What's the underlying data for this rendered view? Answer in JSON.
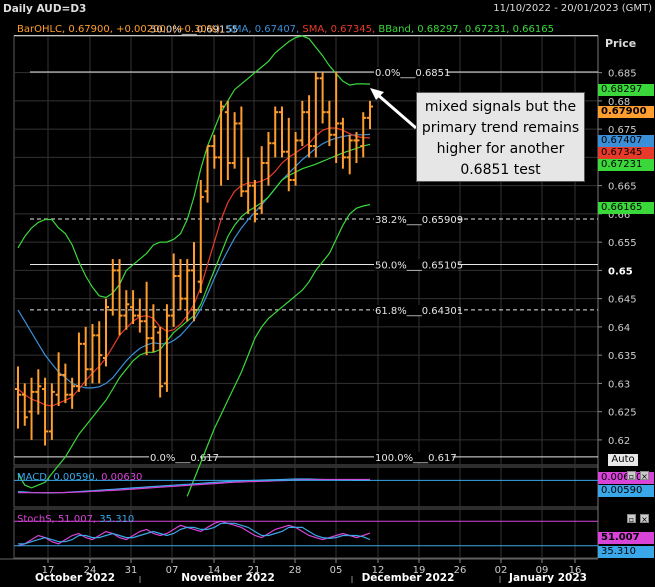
{
  "header": {
    "title": "Daily AUD=D3",
    "date_range": "11/10/2022 - 20/01/2023 (GMT)"
  },
  "legend": {
    "barohlc": "BarOHLC, 0.67900, +0.00200, (+0.30%),",
    "sma1": "SMA, 0.67407,",
    "sma2": "SMA, 0.67345,",
    "bband": "BBand, 0.68297, 0.67231, 0.66165",
    "colors": {
      "barohlc": "#ff9d2e",
      "sma1": "#3a8fd8",
      "sma2": "#e83a2a",
      "bband": "#3bd83b"
    }
  },
  "price_axis_title": "Price",
  "auto_button": "Auto",
  "callout": {
    "line1": "mixed signals but the",
    "line2": "primary trend remains",
    "line3": "higher for another",
    "line4": "0.6851 test"
  },
  "price_boxes": {
    "bb_upper": "0.68297",
    "close": "0.67900",
    "sma1": "0.67407",
    "sma2": "0.67345",
    "bb_mid": "0.67231",
    "bb_lower": "0.66165"
  },
  "macd": {
    "legend_label": "MACD,",
    "value1": "0.00590,",
    "value2": "0.00630",
    "box1": "0.00630",
    "box2": "0.00590"
  },
  "stochs": {
    "legend_label": "StochS,",
    "value1": "51.007,",
    "value2": "35.310",
    "box1": "51.007",
    "box2": "35.310"
  },
  "chart_data": {
    "type": "bar",
    "subtype": "ohlc",
    "title": "Daily AUD=D3",
    "ylim": [
      0.615,
      0.6915
    ],
    "y_ticks": [
      "0.685",
      "0.68",
      "0.675",
      "0.67",
      "0.665",
      "0.66",
      "0.655",
      "0.65",
      "0.645",
      "0.64",
      "0.635",
      "0.63",
      "0.625",
      "0.62"
    ],
    "y_ticks_bold": [
      "0.65"
    ],
    "x_day_labels": [
      "17",
      "24",
      "31",
      "07",
      "14",
      "21",
      "28",
      "05",
      "12",
      "19",
      "26",
      "02",
      "09",
      "16"
    ],
    "x_month_labels": [
      "October 2022",
      "November 2022",
      "December 2022",
      "January 2023"
    ],
    "fib_levels": [
      {
        "label": "50.0%",
        "value": 0.69155,
        "text": "0.69155"
      },
      {
        "label": "0.0%",
        "value": 0.6851,
        "text": "0.6851"
      },
      {
        "label": "38.2%",
        "value": 0.65909,
        "text": "0.65909"
      },
      {
        "label": "50.0%",
        "value": 0.65105,
        "text": "0.65105"
      },
      {
        "label": "61.8%",
        "value": 0.64301,
        "text": "0.64301"
      },
      {
        "label": "0.0%",
        "value": 0.617,
        "text": "0.617"
      },
      {
        "label": "100.0%",
        "value": 0.617,
        "text": "0.617"
      }
    ],
    "ohlc": [
      [
        0.629,
        0.633,
        0.622,
        0.628
      ],
      [
        0.628,
        0.63,
        0.6225,
        0.624
      ],
      [
        0.625,
        0.631,
        0.62,
        0.6285
      ],
      [
        0.6285,
        0.6325,
        0.6245,
        0.6295
      ],
      [
        0.629,
        0.631,
        0.619,
        0.6215
      ],
      [
        0.6215,
        0.63,
        0.62,
        0.6285
      ],
      [
        0.628,
        0.6355,
        0.626,
        0.6315
      ],
      [
        0.6315,
        0.6335,
        0.6265,
        0.628
      ],
      [
        0.628,
        0.631,
        0.6255,
        0.6295
      ],
      [
        0.6295,
        0.639,
        0.6285,
        0.637
      ],
      [
        0.637,
        0.64,
        0.6295,
        0.6325
      ],
      [
        0.6325,
        0.6405,
        0.63,
        0.6385
      ],
      [
        0.6385,
        0.641,
        0.63,
        0.635
      ],
      [
        0.6345,
        0.645,
        0.633,
        0.6435
      ],
      [
        0.643,
        0.652,
        0.642,
        0.65
      ],
      [
        0.65,
        0.652,
        0.6385,
        0.642
      ],
      [
        0.642,
        0.6465,
        0.6395,
        0.644
      ],
      [
        0.6435,
        0.6465,
        0.6405,
        0.642
      ],
      [
        0.642,
        0.645,
        0.639,
        0.641
      ],
      [
        0.641,
        0.648,
        0.635,
        0.638
      ],
      [
        0.638,
        0.644,
        0.6355,
        0.64
      ],
      [
        0.639,
        0.64,
        0.6275,
        0.6295
      ],
      [
        0.63,
        0.644,
        0.6285,
        0.642
      ],
      [
        0.642,
        0.653,
        0.64,
        0.649
      ],
      [
        0.649,
        0.652,
        0.643,
        0.645
      ],
      [
        0.645,
        0.652,
        0.641,
        0.65
      ],
      [
        0.65,
        0.655,
        0.641,
        0.643
      ],
      [
        0.648,
        0.666,
        0.646,
        0.663
      ],
      [
        0.664,
        0.672,
        0.662,
        0.672
      ],
      [
        0.672,
        0.674,
        0.668,
        0.67
      ],
      [
        0.67,
        0.68,
        0.665,
        0.679
      ],
      [
        0.678,
        0.68,
        0.666,
        0.669
      ],
      [
        0.669,
        0.678,
        0.668,
        0.676
      ],
      [
        0.676,
        0.679,
        0.663,
        0.664
      ],
      [
        0.664,
        0.67,
        0.66,
        0.665
      ],
      [
        0.665,
        0.666,
        0.6585,
        0.66
      ],
      [
        0.661,
        0.672,
        0.66,
        0.669
      ],
      [
        0.669,
        0.6745,
        0.665,
        0.6725
      ],
      [
        0.6725,
        0.679,
        0.67,
        0.678
      ],
      [
        0.678,
        0.679,
        0.67,
        0.671
      ],
      [
        0.671,
        0.677,
        0.664,
        0.666
      ],
      [
        0.666,
        0.6745,
        0.665,
        0.673
      ],
      [
        0.673,
        0.68,
        0.672,
        0.678
      ],
      [
        0.678,
        0.681,
        0.67,
        0.672
      ],
      [
        0.672,
        0.6851,
        0.67,
        0.684
      ],
      [
        0.684,
        0.6851,
        0.676,
        0.678
      ],
      [
        0.678,
        0.68,
        0.672,
        0.674
      ],
      [
        0.674,
        0.6851,
        0.669,
        0.676
      ],
      [
        0.676,
        0.677,
        0.668,
        0.67
      ],
      [
        0.67,
        0.674,
        0.667,
        0.673
      ],
      [
        0.673,
        0.6745,
        0.669,
        0.673
      ],
      [
        0.672,
        0.678,
        0.67,
        0.677
      ],
      [
        0.677,
        0.68,
        0.675,
        0.679
      ]
    ],
    "series": [
      {
        "name": "SMA",
        "color": "#3a8fd8",
        "values": [
          0.643,
          0.641,
          0.639,
          0.637,
          0.635,
          0.6335,
          0.632,
          0.631,
          0.63,
          0.6295,
          0.6292,
          0.6292,
          0.6294,
          0.63,
          0.631,
          0.6325,
          0.634,
          0.6352,
          0.6362,
          0.6368,
          0.6372,
          0.637,
          0.637,
          0.6376,
          0.6385,
          0.6398,
          0.6412,
          0.6432,
          0.6458,
          0.6486,
          0.6512,
          0.6535,
          0.6557,
          0.6575,
          0.659,
          0.6603,
          0.6616,
          0.663,
          0.6645,
          0.666,
          0.6672,
          0.6684,
          0.6696,
          0.6706,
          0.6716,
          0.6724,
          0.673,
          0.6734,
          0.6737,
          0.6739,
          0.674,
          0.674,
          0.67407
        ]
      },
      {
        "name": "SMA",
        "color": "#e83a2a",
        "values": [
          0.629,
          0.628,
          0.6272,
          0.6268,
          0.6262,
          0.626,
          0.6265,
          0.627,
          0.6276,
          0.629,
          0.6305,
          0.6318,
          0.633,
          0.6345,
          0.6365,
          0.6385,
          0.6398,
          0.641,
          0.6418,
          0.642,
          0.6415,
          0.64,
          0.6392,
          0.6395,
          0.6405,
          0.642,
          0.644,
          0.647,
          0.651,
          0.655,
          0.659,
          0.662,
          0.664,
          0.665,
          0.6655,
          0.6655,
          0.6658,
          0.6664,
          0.6675,
          0.669,
          0.67,
          0.6708,
          0.6716,
          0.6725,
          0.6738,
          0.6748,
          0.6752,
          0.6752,
          0.6748,
          0.6742,
          0.6737,
          0.6735,
          0.67345
        ]
      },
      {
        "name": "BBand",
        "color": "#3bd83b",
        "values": [
          0.654,
          0.656,
          0.6575,
          0.6585,
          0.659,
          0.659,
          0.6575,
          0.6565,
          0.6545,
          0.6515,
          0.649,
          0.647,
          0.6455,
          0.6452,
          0.646,
          0.6475,
          0.65,
          0.651,
          0.652,
          0.653,
          0.6545,
          0.655,
          0.655,
          0.6555,
          0.6565,
          0.659,
          0.663,
          0.668,
          0.672,
          0.675,
          0.678,
          0.68,
          0.682,
          0.683,
          0.684,
          0.685,
          0.686,
          0.687,
          0.6885,
          0.6895,
          0.6905,
          0.6912,
          0.6915,
          0.691,
          0.6895,
          0.688,
          0.6862,
          0.6848,
          0.6835,
          0.6828,
          0.683,
          0.683,
          0.68297
        ]
      },
      {
        "name": "BBand",
        "color": "#3bd83b",
        "values": [
          0.614,
          0.612,
          0.6115,
          0.612,
          0.6125,
          0.614,
          0.6155,
          0.617,
          0.619,
          0.621,
          0.6225,
          0.624,
          0.6255,
          0.627,
          0.629,
          0.631,
          0.6325,
          0.634,
          0.635,
          0.6355,
          0.6355,
          0.636,
          0.6375,
          0.639,
          0.64,
          0.641,
          0.642,
          0.644,
          0.647,
          0.65,
          0.653,
          0.656,
          0.658,
          0.6595,
          0.6605,
          0.6612,
          0.662,
          0.663,
          0.6645,
          0.666,
          0.6668,
          0.6674,
          0.668,
          0.6684,
          0.6688,
          0.6693,
          0.6698,
          0.6703,
          0.6708,
          0.6712,
          0.6716,
          0.672,
          0.67231
        ]
      },
      {
        "name": "BBand",
        "color": "#3bd83b",
        "values": [
          null,
          null,
          null,
          null,
          null,
          null,
          null,
          null,
          null,
          null,
          null,
          null,
          null,
          null,
          null,
          null,
          null,
          null,
          null,
          null,
          null,
          null,
          null,
          null,
          null,
          0.61,
          0.613,
          0.616,
          0.619,
          0.622,
          0.6245,
          0.627,
          0.6295,
          0.632,
          0.635,
          0.638,
          0.64,
          0.6415,
          0.6425,
          0.6435,
          0.6445,
          0.6455,
          0.6465,
          0.648,
          0.65,
          0.6515,
          0.653,
          0.6555,
          0.658,
          0.66,
          0.661,
          0.6614,
          0.66165
        ]
      }
    ],
    "macd": {
      "ylim": [
        -0.004,
        0.01
      ],
      "macd_line": [
        0.001,
        0.0008,
        0.0006,
        0.0005,
        0.0004,
        0.0004,
        0.0005,
        0.0006,
        0.0008,
        0.001,
        0.0012,
        0.0014,
        0.0016,
        0.0018,
        0.002,
        0.0022,
        0.0024,
        0.0026,
        0.0028,
        0.003,
        0.0032,
        0.0034,
        0.0036,
        0.0038,
        0.004,
        0.0042,
        0.0044,
        0.0046,
        0.0048,
        0.005,
        0.0052,
        0.0054,
        0.0056,
        0.0057,
        0.0058,
        0.0059,
        0.006,
        0.0061,
        0.0062,
        0.0063,
        0.0064,
        0.0065,
        0.0065,
        0.0065,
        0.0064,
        0.0063,
        0.0062,
        0.0061,
        0.006,
        0.006,
        0.0059,
        0.0059,
        0.0059
      ],
      "signal_line": [
        0.0005,
        0.0005,
        0.0005,
        0.0005,
        0.0005,
        0.0005,
        0.0005,
        0.0006,
        0.0007,
        0.0008,
        0.0009,
        0.0011,
        0.0012,
        0.0014,
        0.0015,
        0.0017,
        0.0019,
        0.0021,
        0.0023,
        0.0025,
        0.0027,
        0.0029,
        0.0031,
        0.0033,
        0.0035,
        0.0037,
        0.0039,
        0.0041,
        0.0043,
        0.0045,
        0.0047,
        0.0049,
        0.0051,
        0.0052,
        0.0053,
        0.0054,
        0.0055,
        0.0056,
        0.0057,
        0.0058,
        0.0059,
        0.006,
        0.0061,
        0.0062,
        0.0062,
        0.0063,
        0.0063,
        0.0063,
        0.0063,
        0.0063,
        0.0063,
        0.0063,
        0.0063
      ]
    },
    "stochs": {
      "ylim": [
        0,
        100
      ],
      "k": [
        20,
        25,
        35,
        45,
        40,
        30,
        25,
        35,
        45,
        50,
        40,
        35,
        45,
        55,
        50,
        40,
        35,
        45,
        55,
        60,
        50,
        45,
        50,
        60,
        70,
        65,
        60,
        55,
        65,
        75,
        80,
        75,
        70,
        65,
        55,
        45,
        40,
        50,
        60,
        65,
        70,
        65,
        55,
        45,
        40,
        35,
        40,
        45,
        50,
        45,
        40,
        45,
        51
      ],
      "d": [
        25,
        25,
        30,
        35,
        40,
        35,
        30,
        30,
        35,
        45,
        45,
        40,
        40,
        45,
        50,
        45,
        40,
        40,
        45,
        50,
        55,
        50,
        45,
        50,
        60,
        65,
        65,
        60,
        60,
        65,
        75,
        75,
        75,
        70,
        65,
        55,
        45,
        45,
        50,
        55,
        65,
        65,
        65,
        55,
        45,
        40,
        38,
        40,
        45,
        45,
        45,
        42,
        35
      ]
    }
  }
}
